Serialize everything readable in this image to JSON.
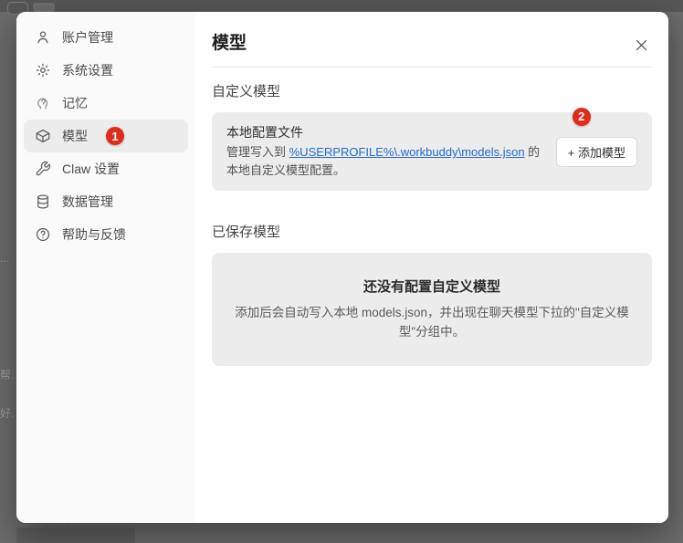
{
  "colors": {
    "badge": "#e02b1d",
    "link": "#2468d3",
    "card_bg": "#ececec",
    "sidebar_bg": "#fafafa"
  },
  "background": {
    "fragments": [
      "...",
      "帮..",
      "好."
    ]
  },
  "sidebar": {
    "items": [
      {
        "label": "账户管理",
        "icon": "user-icon",
        "selected": false
      },
      {
        "label": "系统设置",
        "icon": "gear-icon",
        "selected": false
      },
      {
        "label": "记忆",
        "icon": "memory-icon",
        "selected": false
      },
      {
        "label": "模型",
        "icon": "cube-icon",
        "selected": true,
        "badge": "1"
      },
      {
        "label": "Claw 设置",
        "icon": "wrench-icon",
        "selected": false
      },
      {
        "label": "数据管理",
        "icon": "database-icon",
        "selected": false
      },
      {
        "label": "帮助与反馈",
        "icon": "help-icon",
        "selected": false
      }
    ]
  },
  "panel": {
    "title": "模型",
    "custom_section": {
      "heading": "自定义模型",
      "card_title": "本地配置文件",
      "desc_prefix": "管理写入到 ",
      "desc_link": "%USERPROFILE%\\.workbuddy\\models.json",
      "desc_suffix": " 的本地自定义模型配置。",
      "add_button_label": "+ 添加模型",
      "step_badge": "2"
    },
    "saved_section": {
      "heading": "已保存模型",
      "empty_title": "还没有配置自定义模型",
      "empty_desc": "添加后会自动写入本地 models.json，并出现在聊天模型下拉的\"自定义模型\"分组中。"
    }
  }
}
